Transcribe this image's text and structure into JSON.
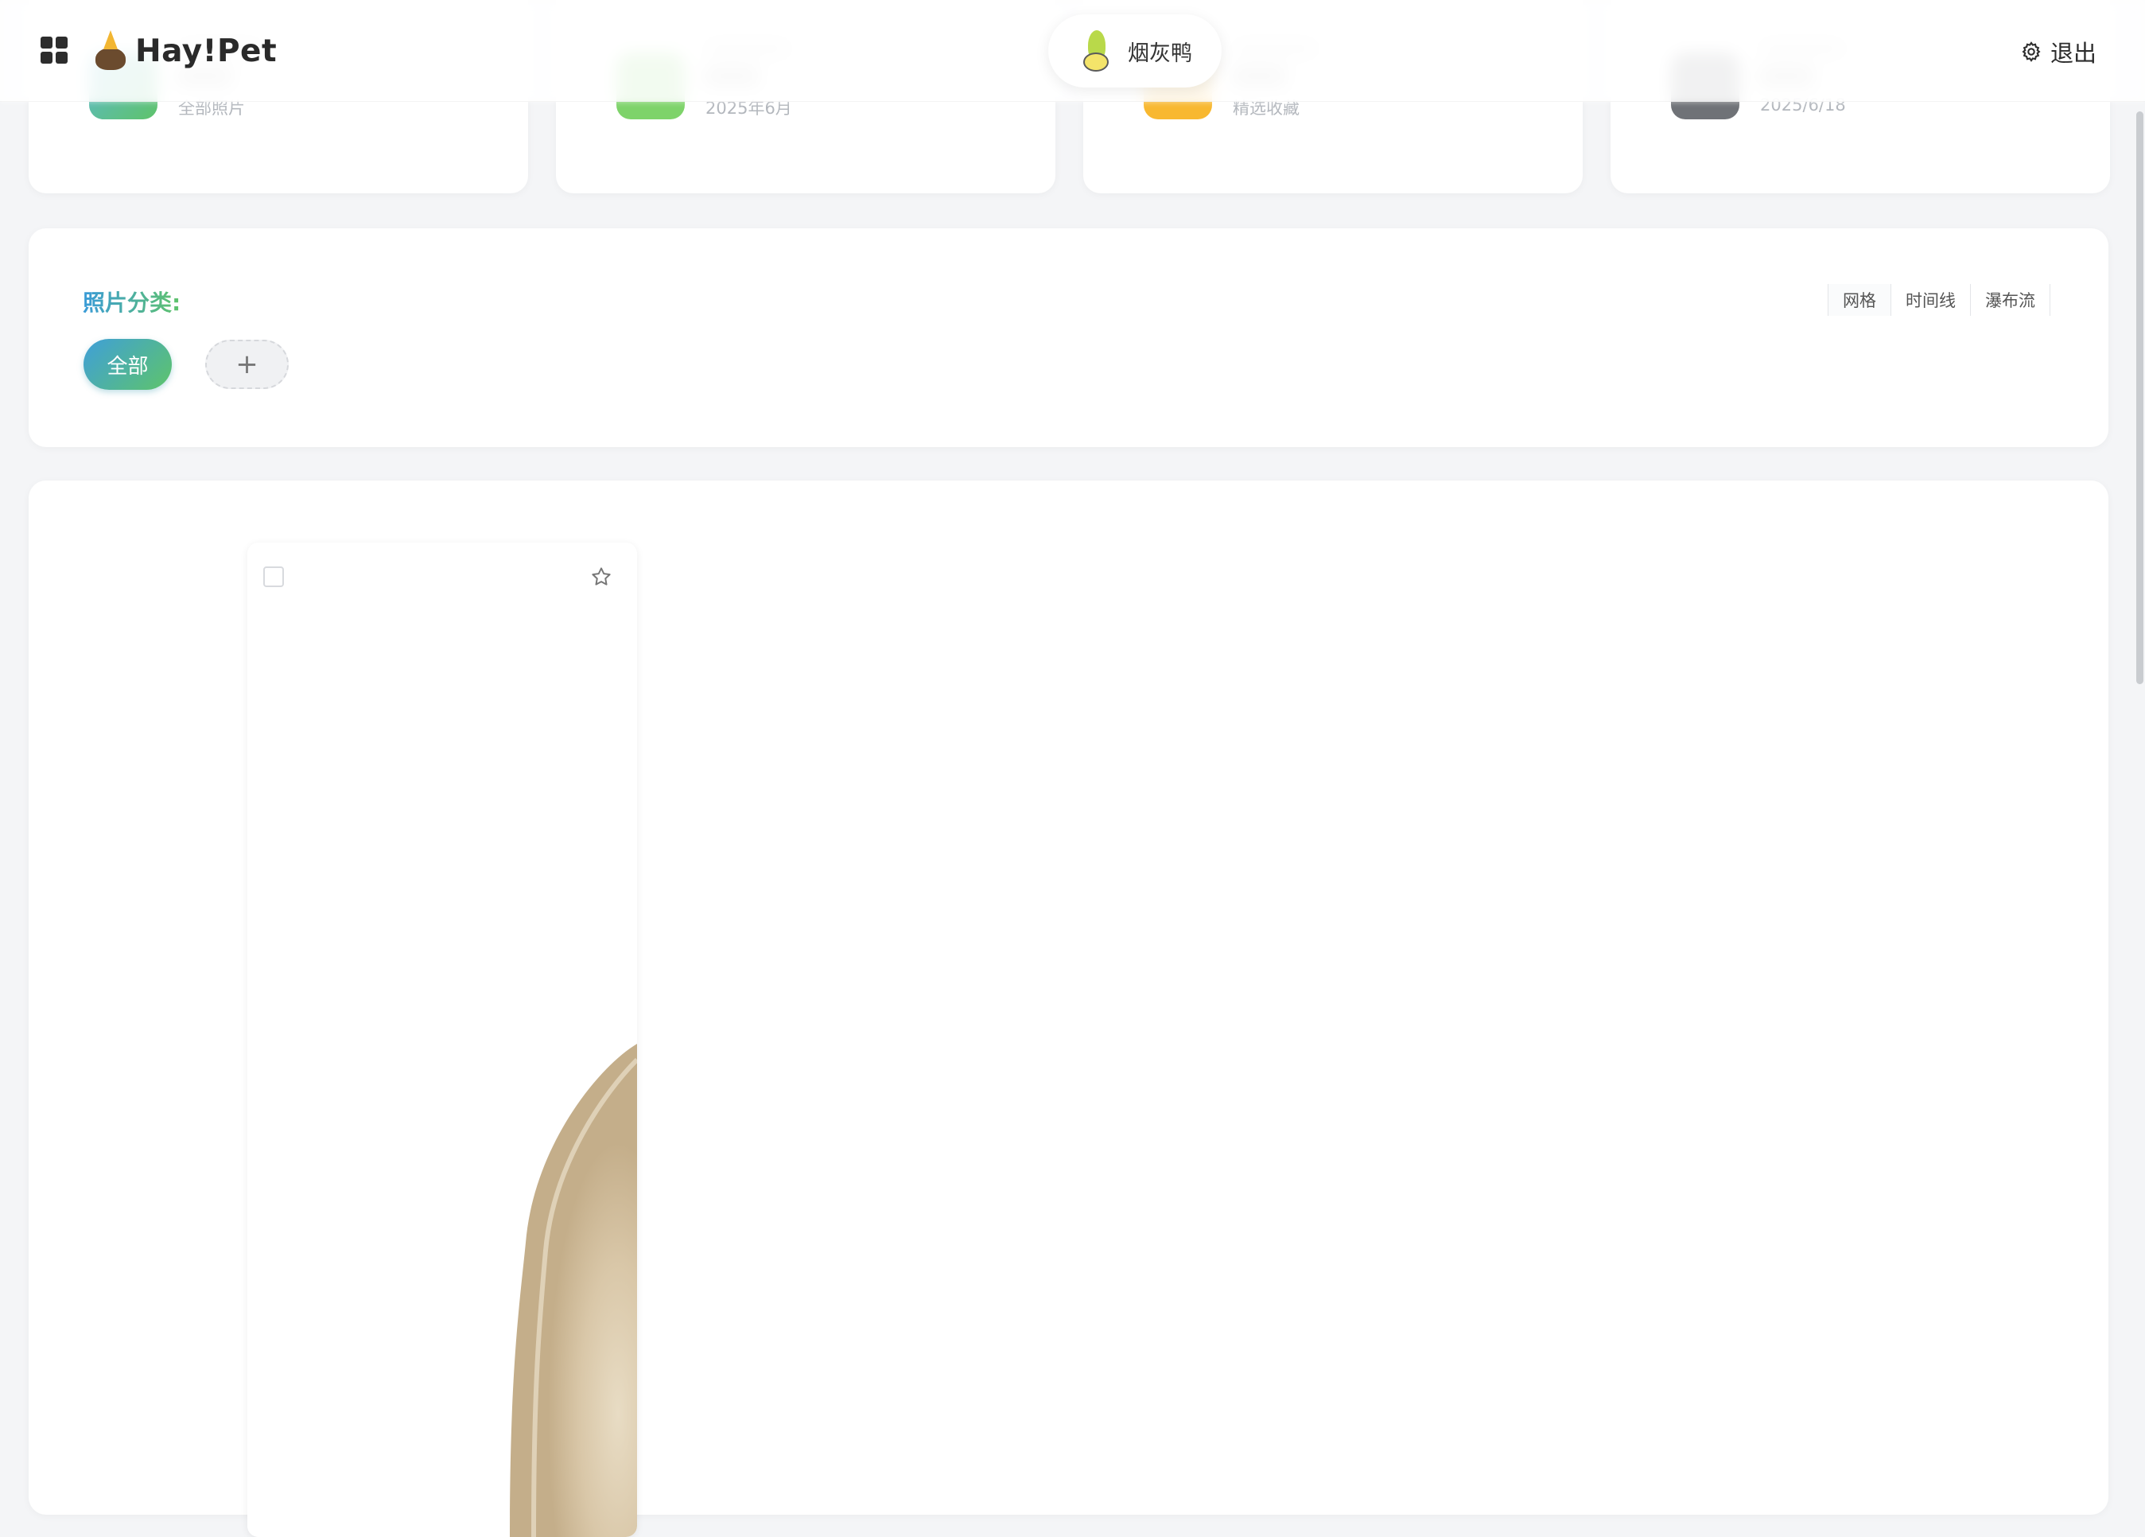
{
  "header": {
    "logo_text": "Hay!Pet",
    "user_name": "烟灰鸭",
    "logout_label": "退出"
  },
  "stats": [
    {
      "subtitle": "全部照片",
      "color": "#5fc36a"
    },
    {
      "subtitle": "2025年6月",
      "color": "#7ed36a"
    },
    {
      "subtitle": "精选收藏",
      "color": "#f8b830"
    },
    {
      "subtitle": "2025/6/18",
      "color": "#6f7277"
    }
  ],
  "categories": {
    "title": "照片分类:",
    "chips": [
      "全部"
    ],
    "add_label": "+"
  },
  "view_modes": [
    "网格",
    "时间线",
    "瀑布流"
  ],
  "colors": {
    "accent_start": "#3f9fd9",
    "accent_end": "#5ec46a",
    "page_bg": "#f4f5f7"
  },
  "icons": [
    "grid-menu-icon",
    "pet-logo-icon",
    "user-avatar-icon",
    "gear-icon",
    "star-icon",
    "checkbox-icon"
  ]
}
